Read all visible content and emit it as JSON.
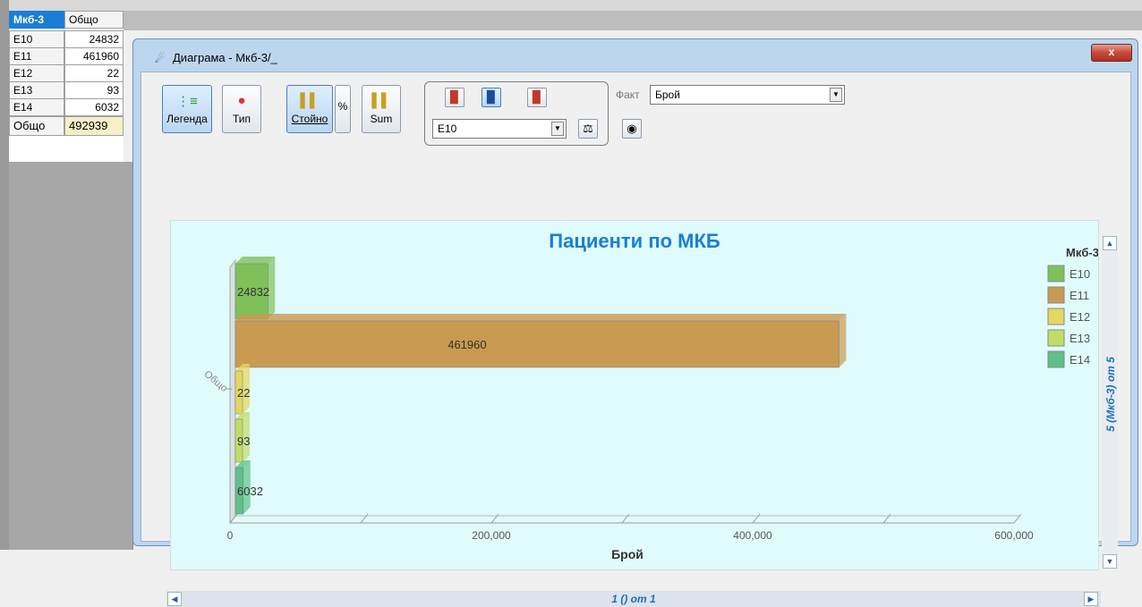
{
  "grid": {
    "header_col1": "Мкб-3",
    "header_col2": "Общо",
    "rows": [
      {
        "label": "E10",
        "value": "24832"
      },
      {
        "label": "E11",
        "value": "461960"
      },
      {
        "label": "E12",
        "value": "22"
      },
      {
        "label": "E13",
        "value": "93"
      },
      {
        "label": "E14",
        "value": "6032"
      }
    ],
    "total_label": "Общо",
    "total_value": "492939"
  },
  "window": {
    "title": "Диаграма - Мкб-3/_",
    "close_glyph": "x"
  },
  "toolbar": {
    "legend_label": "Легенда",
    "type_label": "Тип",
    "values_label": "Стойнo",
    "percent_label": "%",
    "sum_label": "Sum",
    "series_select": "E10",
    "fact_label": "Факт",
    "fact_select": "Брой"
  },
  "navigation": {
    "vertical_label": "5 (Мкб-3) от 5",
    "horizontal_label": "1 () от 1"
  },
  "colors": {
    "E10": "#7fc05a",
    "E11": "#c99a52",
    "E12": "#e3d760",
    "E13": "#c2dc6a",
    "E14": "#5fc088",
    "title": "#1a7fd4",
    "chart_bg": "#e0fbfb"
  },
  "chart_data": {
    "type": "bar",
    "orientation": "horizontal",
    "title": "Пациенти по МКБ",
    "xlabel": "Брой",
    "ylabel": "",
    "category_label": "Общо",
    "xlim": [
      0,
      600000
    ],
    "xticks": [
      "0",
      "200,000",
      "400,000",
      "600,000"
    ],
    "legend_title": "Мкб-3",
    "legend_position": "right",
    "series": [
      {
        "name": "E10",
        "value": 24832,
        "label": "24832"
      },
      {
        "name": "E11",
        "value": 461960,
        "label": "461960"
      },
      {
        "name": "E12",
        "value": 22,
        "label": "22"
      },
      {
        "name": "E13",
        "value": 93,
        "label": "93"
      },
      {
        "name": "E14",
        "value": 6032,
        "label": "6032"
      }
    ]
  }
}
